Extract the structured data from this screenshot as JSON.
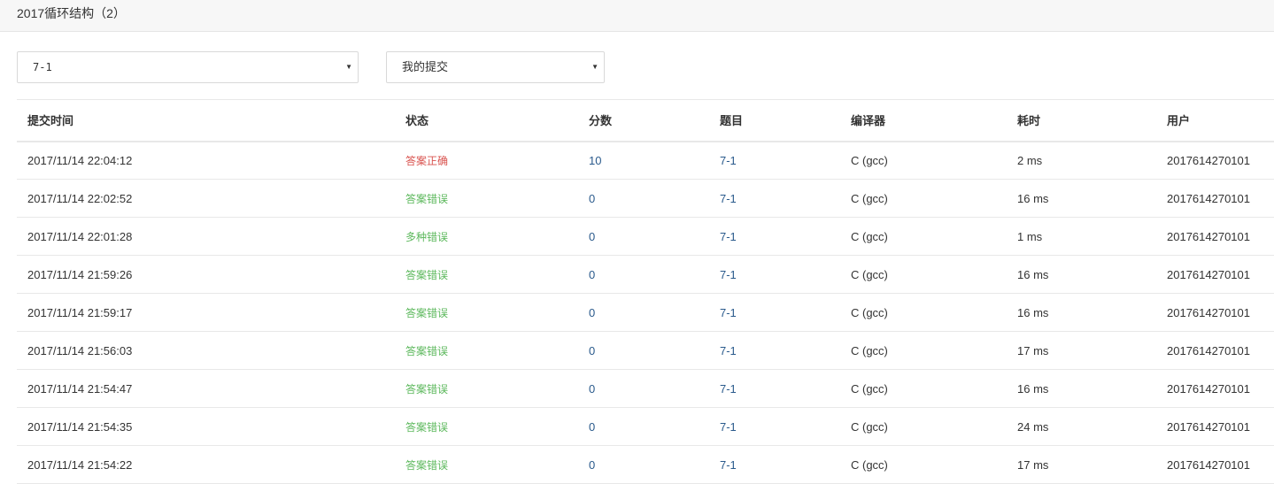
{
  "header": {
    "title": "2017循环结构（2）"
  },
  "filters": {
    "problem": {
      "value": "7-1"
    },
    "scope": {
      "value": "我的提交"
    }
  },
  "table": {
    "columns": [
      "提交时间",
      "状态",
      "分数",
      "题目",
      "编译器",
      "耗时",
      "用户"
    ],
    "rows": [
      {
        "time": "2017/11/14 22:04:12",
        "status": "答案正确",
        "ok": true,
        "score": "10",
        "problem": "7-1",
        "compiler": "C (gcc)",
        "cost": "2 ms",
        "user": "2017614270101"
      },
      {
        "time": "2017/11/14 22:02:52",
        "status": "答案错误",
        "ok": false,
        "score": "0",
        "problem": "7-1",
        "compiler": "C (gcc)",
        "cost": "16 ms",
        "user": "2017614270101"
      },
      {
        "time": "2017/11/14 22:01:28",
        "status": "多种错误",
        "ok": false,
        "score": "0",
        "problem": "7-1",
        "compiler": "C (gcc)",
        "cost": "1 ms",
        "user": "2017614270101"
      },
      {
        "time": "2017/11/14 21:59:26",
        "status": "答案错误",
        "ok": false,
        "score": "0",
        "problem": "7-1",
        "compiler": "C (gcc)",
        "cost": "16 ms",
        "user": "2017614270101"
      },
      {
        "time": "2017/11/14 21:59:17",
        "status": "答案错误",
        "ok": false,
        "score": "0",
        "problem": "7-1",
        "compiler": "C (gcc)",
        "cost": "16 ms",
        "user": "2017614270101"
      },
      {
        "time": "2017/11/14 21:56:03",
        "status": "答案错误",
        "ok": false,
        "score": "0",
        "problem": "7-1",
        "compiler": "C (gcc)",
        "cost": "17 ms",
        "user": "2017614270101"
      },
      {
        "time": "2017/11/14 21:54:47",
        "status": "答案错误",
        "ok": false,
        "score": "0",
        "problem": "7-1",
        "compiler": "C (gcc)",
        "cost": "16 ms",
        "user": "2017614270101"
      },
      {
        "time": "2017/11/14 21:54:35",
        "status": "答案错误",
        "ok": false,
        "score": "0",
        "problem": "7-1",
        "compiler": "C (gcc)",
        "cost": "24 ms",
        "user": "2017614270101"
      },
      {
        "time": "2017/11/14 21:54:22",
        "status": "答案错误",
        "ok": false,
        "score": "0",
        "problem": "7-1",
        "compiler": "C (gcc)",
        "cost": "17 ms",
        "user": "2017614270101"
      }
    ]
  },
  "icons": {
    "dropdown": "caret-down-icon"
  },
  "colors": {
    "accepted": "#d9534f",
    "wrong": "#5cb85c",
    "link": "#2a5a8c"
  }
}
